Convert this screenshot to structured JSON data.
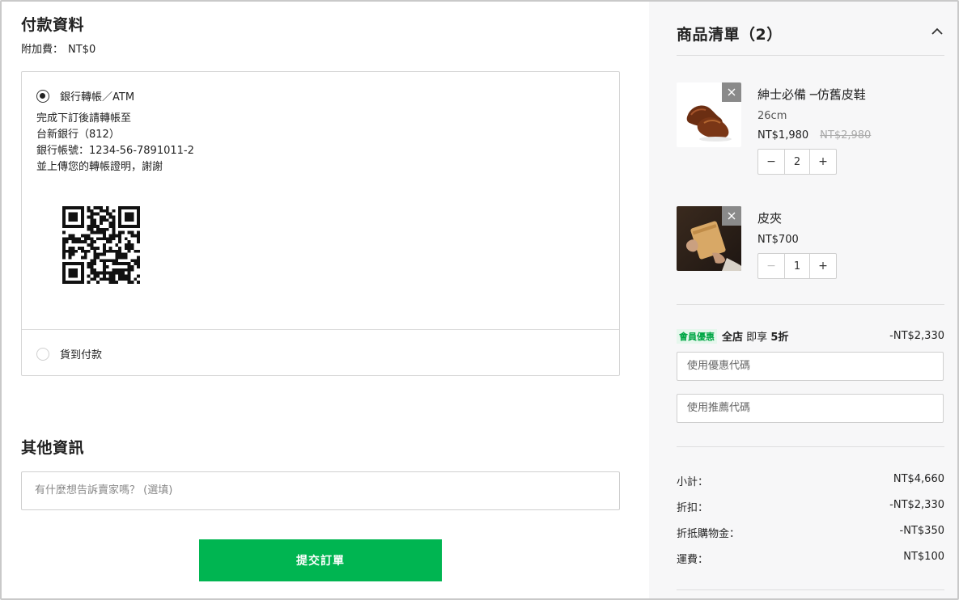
{
  "payment": {
    "title": "付款資料",
    "surcharge_label": "附加費：",
    "surcharge_value": "NT$0",
    "options": [
      {
        "label": "銀行轉帳／ATM",
        "selected": true
      },
      {
        "label": "貨到付款",
        "selected": false
      }
    ],
    "bank_lines": [
      "完成下訂後請轉帳至",
      "台新銀行（812）",
      "銀行帳號：1234-56-7891011-2",
      "並上傳您的轉帳證明，謝謝"
    ]
  },
  "other": {
    "title": "其他資訊",
    "note_placeholder": "有什麼想告訴賣家嗎？ (選填)"
  },
  "submit_label": "提交訂單",
  "cart": {
    "title": "商品清單（2）",
    "items": [
      {
        "name": "紳士必備 ─仿舊皮鞋",
        "variant": "26cm",
        "price": "NT$1,980",
        "original_price": "NT$2,980",
        "qty": "2",
        "minus_enabled": true
      },
      {
        "name": "皮夾",
        "variant": "",
        "price": "NT$700",
        "original_price": "",
        "qty": "1",
        "minus_enabled": false
      }
    ],
    "promo": {
      "badge": "會員優惠",
      "scope": "全店",
      "text": "即享",
      "discount": "5折",
      "amount": "-NT$2,330"
    },
    "coupon_placeholder": "使用優惠代碼",
    "referral_placeholder": "使用推薦代碼",
    "summary": [
      {
        "label": "小計：",
        "value": "NT$4,660"
      },
      {
        "label": "折扣：",
        "value": "-NT$2,330"
      },
      {
        "label": "折抵購物金：",
        "value": "-NT$350"
      },
      {
        "label": "運費：",
        "value": "NT$100"
      }
    ]
  },
  "colors": {
    "accent": "#00b551",
    "panel_bg": "#f7f7f8",
    "promo_green": "#00a645"
  }
}
